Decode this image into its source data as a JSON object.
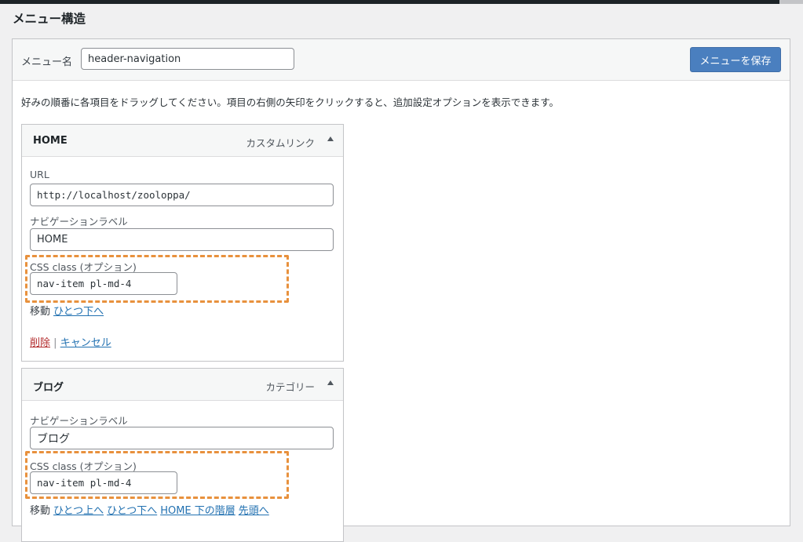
{
  "section_title": "メニュー構造",
  "menu_name": {
    "label": "メニュー名",
    "value": "header-navigation"
  },
  "save_button": "メニューを保存",
  "instructions": "好みの順番に各項目をドラッグしてください。項目の右側の矢印をクリックすると、追加設定オプションを表示できます。",
  "items": [
    {
      "title": "HOME",
      "type": "カスタムリンク",
      "url_label": "URL",
      "url_value": "http://localhost/zooloppa/",
      "nav_label": "ナビゲーションラベル",
      "nav_value": "HOME",
      "css_label": "CSS class (オプション)",
      "css_value": "nav-item pl-md-4",
      "move_label": "移動",
      "move_links": [
        "ひとつ下へ"
      ],
      "delete_label": "削除",
      "separator": "|",
      "cancel_label": "キャンセル"
    },
    {
      "title": "ブログ",
      "type": "カテゴリー",
      "nav_label": "ナビゲーションラベル",
      "nav_value": "ブログ",
      "css_label": "CSS class (オプション)",
      "css_value": "nav-item pl-md-4",
      "move_label": "移動",
      "move_links": [
        "ひとつ上へ",
        "ひとつ下へ",
        "HOME 下の階層",
        "先頭へ"
      ]
    }
  ],
  "colors": {
    "accent": "#4a7fbf",
    "link": "#2271b1",
    "delete": "#b32d2e",
    "highlight": "#e8913d"
  }
}
